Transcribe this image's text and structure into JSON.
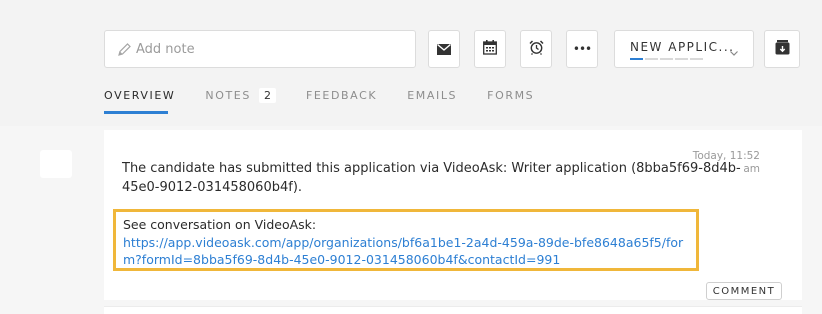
{
  "note": {
    "placeholder": "Add note"
  },
  "toolbar": {
    "email_icon": "envelope-icon",
    "calendar_icon": "calendar-icon",
    "alarm_icon": "alarm-clock-icon",
    "more_label": "•••",
    "stage_label": "NEW APPLIC...",
    "stage_progress": 0.2,
    "archive_icon": "archive-box-icon"
  },
  "tabs": [
    {
      "label": "OVERVIEW",
      "active": true
    },
    {
      "label": "NOTES",
      "count": "2"
    },
    {
      "label": "FEEDBACK"
    },
    {
      "label": "EMAILS"
    },
    {
      "label": "FORMS"
    }
  ],
  "activity": {
    "timestamp": "Today, 11:52 am",
    "message": "The candidate has submitted this application via VideoAsk: Writer application (8bba5f69-8d4b-45e0-9012-031458060b4f).",
    "conversation_label": "See conversation on VideoAsk:",
    "conversation_link": "https://app.videoask.com/app/organizations/bf6a1be1-2a4d-459a-89de-bfe8648a65f5/form?formId=8bba5f69-8d4b-45e0-9012-031458060b4f&contactId=991",
    "comment_label": "COMMENT"
  },
  "colors": {
    "accent": "#2d7fd3",
    "highlight": "#f0b73a"
  }
}
